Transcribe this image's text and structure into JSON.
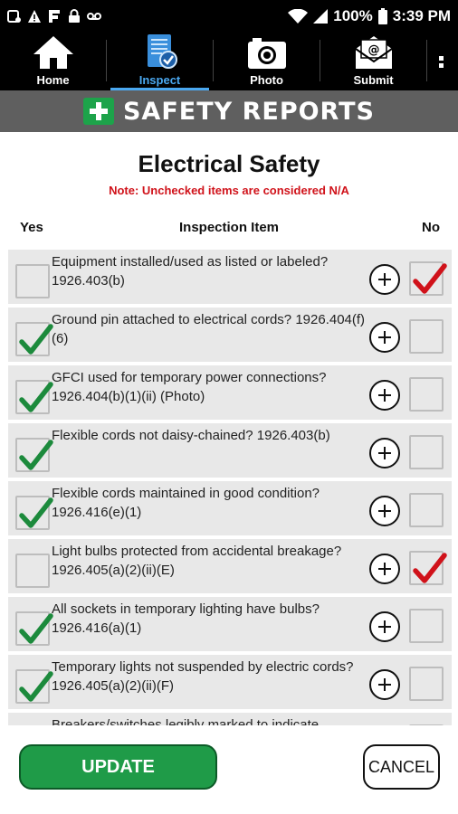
{
  "status_bar": {
    "left_icons": [
      "record-icon",
      "alert-icon",
      "font-icon",
      "lock-icon",
      "voicemail-icon"
    ],
    "battery": "100%",
    "time": "3:39 PM"
  },
  "nav": {
    "items": [
      {
        "label": "Home",
        "icon": "home-icon",
        "active": false
      },
      {
        "label": "Inspect",
        "icon": "clipboard-check-icon",
        "active": true
      },
      {
        "label": "Photo",
        "icon": "camera-icon",
        "active": false
      },
      {
        "label": "Submit",
        "icon": "mail-icon",
        "active": false
      }
    ],
    "accent": "#4aa8f0"
  },
  "banner": {
    "title": "SAFETY REPORTS",
    "cross_color": "#1da34a"
  },
  "page": {
    "title": "Electrical Safety",
    "note": "Note: Unchecked items are considered N/A"
  },
  "columns": {
    "yes": "Yes",
    "item": "Inspection Item",
    "no": "No"
  },
  "items": [
    {
      "text": "Equipment installed/used as listed or labeled? 1926.403(b)",
      "yes": false,
      "no": true
    },
    {
      "text": "Ground pin attached to electrical cords? 1926.404(f)(6)",
      "yes": true,
      "no": false
    },
    {
      "text": "GFCI used for temporary power connections? 1926.404(b)(1)(ii) (Photo)",
      "yes": true,
      "no": false
    },
    {
      "text": "Flexible cords not daisy-chained? 1926.403(b)",
      "yes": true,
      "no": false
    },
    {
      "text": "Flexible cords maintained in good condition? 1926.416(e)(1)",
      "yes": true,
      "no": false
    },
    {
      "text": "Light bulbs protected from accidental breakage? 1926.405(a)(2)(ii)(E)",
      "yes": false,
      "no": true
    },
    {
      "text": "All sockets in temporary lighting have bulbs? 1926.416(a)(1)",
      "yes": true,
      "no": false
    },
    {
      "text": "Temporary lights not suspended by electric cords? 1926.405(a)(2)(ii)(F)",
      "yes": true,
      "no": false
    },
    {
      "text": "Breakers/switches legibly marked to indicate",
      "yes": true,
      "no": false
    }
  ],
  "colors": {
    "yes_check": "#1c8a3c",
    "no_check": "#d0121a"
  },
  "buttons": {
    "update": "UPDATE",
    "cancel": "CANCEL"
  }
}
